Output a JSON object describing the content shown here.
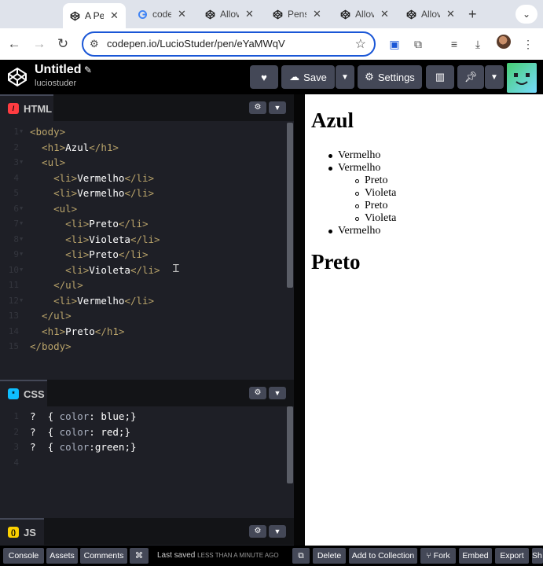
{
  "browser": {
    "tabs": [
      {
        "label": "A Pe",
        "icon": "codepen-icon",
        "active": true
      },
      {
        "label": "code",
        "icon": "google-icon",
        "active": false
      },
      {
        "label": "Allov",
        "icon": "codepen-icon",
        "active": false
      },
      {
        "label": "Pens",
        "icon": "codepen-icon",
        "active": false
      },
      {
        "label": "Allov",
        "icon": "codepen-icon",
        "active": false
      },
      {
        "label": "Allov",
        "icon": "codepen-icon",
        "active": false
      }
    ],
    "url": "codepen.io/LucioStuder/pen/eYaMWqV"
  },
  "header": {
    "title": "Untitled",
    "username": "luciostuder",
    "save_label": "Save",
    "settings_label": "Settings"
  },
  "html_pane": {
    "label": "HTML",
    "lines": [
      {
        "num": "1",
        "fold": true,
        "segments": [
          {
            "t": "<body>",
            "c": "tag"
          }
        ]
      },
      {
        "num": "2",
        "fold": false,
        "segments": [
          {
            "t": "  <h1>",
            "c": "tag"
          },
          {
            "t": "Azul",
            "c": "txt"
          },
          {
            "t": "</h1>",
            "c": "tag"
          }
        ]
      },
      {
        "num": "3",
        "fold": true,
        "segments": [
          {
            "t": "  <ul>",
            "c": "tag"
          }
        ]
      },
      {
        "num": "4",
        "fold": false,
        "segments": [
          {
            "t": "    <li>",
            "c": "tag"
          },
          {
            "t": "Vermelho",
            "c": "txt"
          },
          {
            "t": "</li>",
            "c": "tag"
          }
        ]
      },
      {
        "num": "5",
        "fold": false,
        "segments": [
          {
            "t": "    <li>",
            "c": "tag"
          },
          {
            "t": "Vermelho",
            "c": "txt"
          },
          {
            "t": "</li>",
            "c": "tag"
          }
        ]
      },
      {
        "num": "6",
        "fold": true,
        "segments": [
          {
            "t": "    <ul>",
            "c": "tag"
          }
        ]
      },
      {
        "num": "7",
        "fold": true,
        "segments": [
          {
            "t": "      <li>",
            "c": "tag"
          },
          {
            "t": "Preto",
            "c": "txt"
          },
          {
            "t": "</li>",
            "c": "tag"
          }
        ]
      },
      {
        "num": "8",
        "fold": true,
        "segments": [
          {
            "t": "      <li>",
            "c": "tag"
          },
          {
            "t": "Violeta",
            "c": "txt"
          },
          {
            "t": "</li>",
            "c": "tag"
          }
        ]
      },
      {
        "num": "9",
        "fold": true,
        "segments": [
          {
            "t": "      <li>",
            "c": "tag"
          },
          {
            "t": "Preto",
            "c": "txt"
          },
          {
            "t": "</li>",
            "c": "tag"
          }
        ]
      },
      {
        "num": "10",
        "fold": true,
        "segments": [
          {
            "t": "      <li>",
            "c": "tag"
          },
          {
            "t": "Violeta",
            "c": "txt"
          },
          {
            "t": "</li>",
            "c": "tag"
          }
        ]
      },
      {
        "num": "11",
        "fold": false,
        "segments": [
          {
            "t": "    </ul>",
            "c": "tag"
          }
        ]
      },
      {
        "num": "12",
        "fold": true,
        "segments": [
          {
            "t": "    <li>",
            "c": "tag"
          },
          {
            "t": "Vermelho",
            "c": "txt"
          },
          {
            "t": "</li>",
            "c": "tag"
          }
        ]
      },
      {
        "num": "13",
        "fold": false,
        "segments": [
          {
            "t": "  </ul>",
            "c": "tag"
          }
        ]
      },
      {
        "num": "14",
        "fold": false,
        "segments": [
          {
            "t": "  <h1>",
            "c": "tag"
          },
          {
            "t": "Preto",
            "c": "txt"
          },
          {
            "t": "</h1>",
            "c": "tag"
          }
        ]
      },
      {
        "num": "15",
        "fold": false,
        "segments": [
          {
            "t": "</body>",
            "c": "tag"
          }
        ]
      }
    ]
  },
  "css_pane": {
    "label": "CSS",
    "lines": [
      {
        "num": "1",
        "segments": [
          {
            "t": "?  { ",
            "c": "sel"
          },
          {
            "t": "color",
            "c": "prop"
          },
          {
            "t": ": ",
            "c": "sel"
          },
          {
            "t": "blue",
            "c": "txt"
          },
          {
            "t": ";}",
            "c": "sel"
          }
        ]
      },
      {
        "num": "2",
        "segments": [
          {
            "t": "?  { ",
            "c": "sel"
          },
          {
            "t": "color",
            "c": "prop"
          },
          {
            "t": ": ",
            "c": "sel"
          },
          {
            "t": "red",
            "c": "txt"
          },
          {
            "t": ";}",
            "c": "sel"
          }
        ]
      },
      {
        "num": "3",
        "segments": [
          {
            "t": "?  { ",
            "c": "sel"
          },
          {
            "t": "color",
            "c": "prop"
          },
          {
            "t": ":",
            "c": "sel"
          },
          {
            "t": "green",
            "c": "txt"
          },
          {
            "t": ";}",
            "c": "sel"
          }
        ]
      },
      {
        "num": "4",
        "segments": []
      }
    ]
  },
  "js_pane": {
    "label": "JS"
  },
  "preview": {
    "h1_first": "Azul",
    "h1_second": "Preto",
    "items": [
      {
        "text": "Vermelho",
        "level": 1
      },
      {
        "text": "Vermelho",
        "level": 1
      },
      {
        "text": "Preto",
        "level": 2
      },
      {
        "text": "Violeta",
        "level": 2
      },
      {
        "text": "Preto",
        "level": 2
      },
      {
        "text": "Violeta",
        "level": 2
      },
      {
        "text": "Vermelho",
        "level": 1
      }
    ]
  },
  "footer": {
    "console": "Console",
    "assets": "Assets",
    "comments": "Comments",
    "shortcut_symbol": "⌘",
    "saved_prefix": "Last saved",
    "saved_time": "LESS THAN A MINUTE AGO",
    "delete": "Delete",
    "add_to_collection": "Add to Collection",
    "fork": "Fork",
    "embed": "Embed",
    "export": "Export",
    "share": "Sh"
  },
  "colors": {
    "html_badge": "#ff3c41",
    "css_badge": "#0ebeff",
    "js_badge": "#fcd000",
    "omnibox_border": "#1a56d6"
  }
}
